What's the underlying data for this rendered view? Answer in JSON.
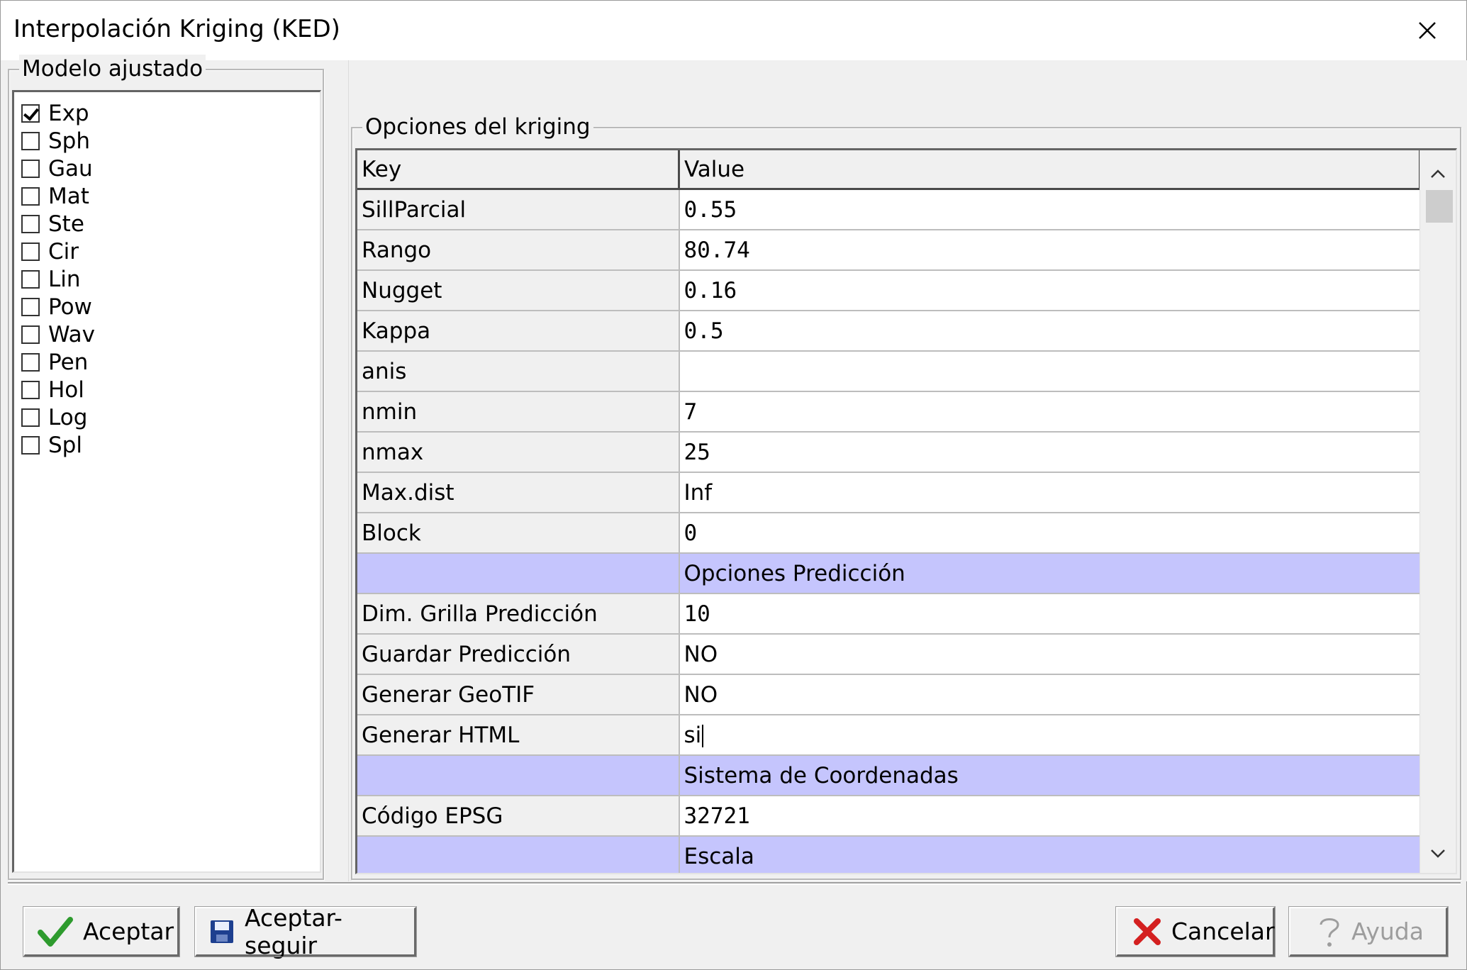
{
  "window": {
    "title": "Interpolación Kriging (KED)",
    "close_label": "✕"
  },
  "model_group": {
    "legend": "Modelo ajustado",
    "items": [
      {
        "label": "Exp",
        "checked": true
      },
      {
        "label": "Sph",
        "checked": false
      },
      {
        "label": "Gau",
        "checked": false
      },
      {
        "label": "Mat",
        "checked": false
      },
      {
        "label": "Ste",
        "checked": false
      },
      {
        "label": "Cir",
        "checked": false
      },
      {
        "label": "Lin",
        "checked": false
      },
      {
        "label": "Pow",
        "checked": false
      },
      {
        "label": "Wav",
        "checked": false
      },
      {
        "label": "Pen",
        "checked": false
      },
      {
        "label": "Hol",
        "checked": false
      },
      {
        "label": "Log",
        "checked": false
      },
      {
        "label": "Spl",
        "checked": false
      }
    ]
  },
  "options_group": {
    "legend": "Opciones del kriging",
    "columns": {
      "key": "Key",
      "value": "Value"
    },
    "rows": [
      {
        "key": "SillParcial",
        "value": "0.55"
      },
      {
        "key": "Rango",
        "value": "80.74"
      },
      {
        "key": "Nugget",
        "value": "0.16"
      },
      {
        "key": "Kappa",
        "value": "0.5"
      },
      {
        "key": "anis",
        "value": ""
      },
      {
        "key": "nmin",
        "value": "7"
      },
      {
        "key": "nmax",
        "value": "25"
      },
      {
        "key": "Max.dist",
        "value": "Inf"
      },
      {
        "key": "Block",
        "value": "0"
      },
      {
        "key": "",
        "value": "Opciones Predicción",
        "section": true
      },
      {
        "key": "Dim. Grilla Predicción",
        "value": "10"
      },
      {
        "key": "Guardar Predicción",
        "value": "NO"
      },
      {
        "key": "Generar GeoTIF",
        "value": "NO"
      },
      {
        "key": "Generar HTML",
        "value": "si",
        "editing": true
      },
      {
        "key": "",
        "value": "Sistema de Coordenadas",
        "section": true
      },
      {
        "key": "Código EPSG",
        "value": "32721"
      },
      {
        "key": "",
        "value": "Escala",
        "section": true
      }
    ]
  },
  "buttons": {
    "accept": "Aceptar",
    "accept_continue": "Aceptar-seguir",
    "cancel": "Cancelar",
    "help": "Ayuda"
  },
  "colors": {
    "section_row": "#c5c5fd",
    "accept_icon": "#2e9b2e",
    "cancel_icon": "#d42020"
  }
}
